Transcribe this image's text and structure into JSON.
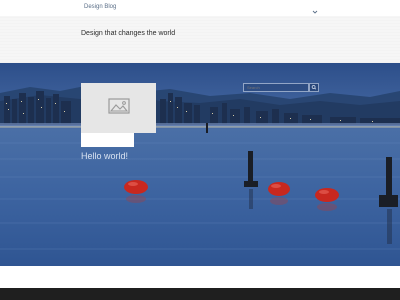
{
  "header": {
    "site_name": "Design Blog",
    "menu_icon": "chevron-down-icon"
  },
  "tagline": "Design that changes the world",
  "hero": {
    "search": {
      "placeholder": "Search",
      "button_icon": "search-icon"
    },
    "post": {
      "thumbnail_icon": "image-icon",
      "read_more_label": "",
      "title": "Hello world!"
    }
  },
  "colors": {
    "topbar_bg": "#ffffff",
    "tagline_bg": "#f6f6f6",
    "footer_bg": "#1f1f1f",
    "link": "#5b6f88"
  }
}
